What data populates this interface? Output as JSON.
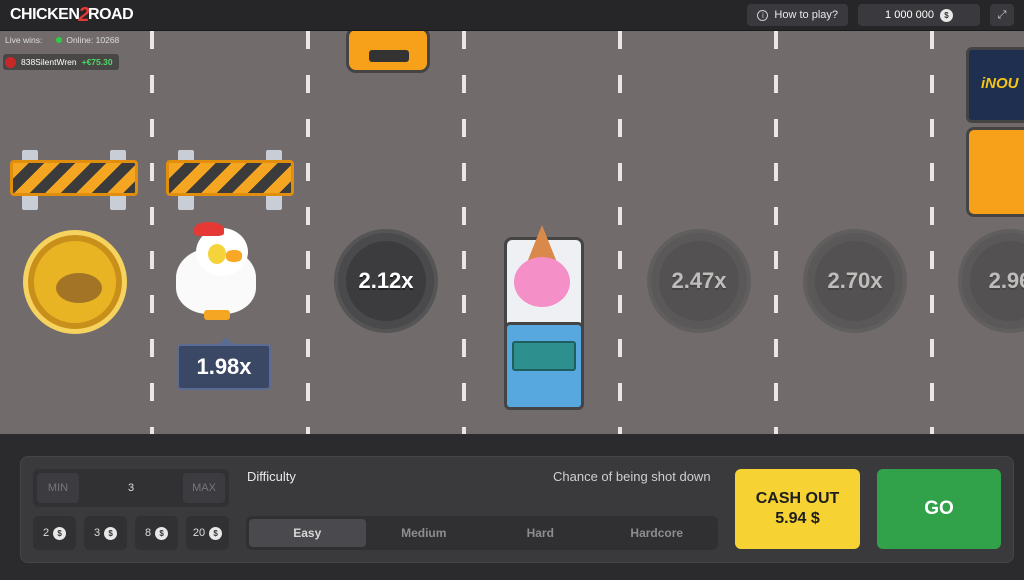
{
  "header": {
    "logo_left": "CHICKEN",
    "logo_mid": "2",
    "logo_right": "ROAD",
    "how_to_play": "How to play?",
    "balance": "1 000 000",
    "currency_symbol": "$"
  },
  "live": {
    "label": "Live wins:",
    "online_label": "Online:",
    "online_count": "10268",
    "recent_winner": {
      "name": "838SilentWren",
      "amount": "+€75.30"
    }
  },
  "game": {
    "current_multiplier": "1.98x",
    "manholes": [
      "2.12x",
      "2.47x",
      "2.70x",
      "2.96"
    ],
    "truck_label": "iNOU",
    "status_color_win": "#4cd964"
  },
  "bet": {
    "min_label": "MIN",
    "max_label": "MAX",
    "value": "3",
    "chips": [
      "2",
      "3",
      "8",
      "20"
    ]
  },
  "difficulty": {
    "label": "Difficulty",
    "chance_label": "Chance of being shot down",
    "options": [
      "Easy",
      "Medium",
      "Hard",
      "Hardcore"
    ],
    "selected": "Easy"
  },
  "actions": {
    "cashout_label": "CASH OUT",
    "cashout_amount": "5.94 $",
    "go_label": "GO",
    "cashout_color": "#f6d232",
    "go_color": "#31a24a"
  }
}
